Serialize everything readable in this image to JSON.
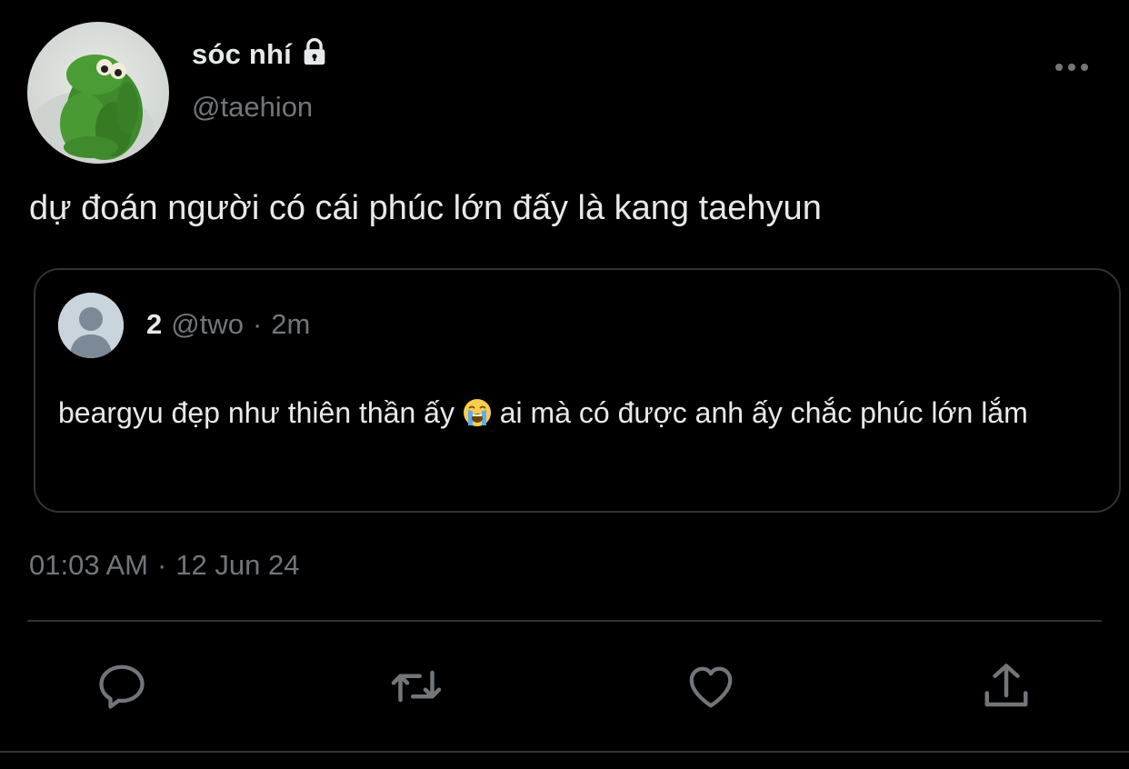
{
  "author": {
    "display_name": "sóc nhí",
    "handle": "@taehion",
    "protected": true,
    "avatar_icon": "kermit-frog-avatar"
  },
  "tweet": {
    "text": "dự đoán người có cái phúc lớn đấy là kang taehyun",
    "time": "01:03 AM",
    "separator": "·",
    "date": "12 Jun 24"
  },
  "quoted": {
    "name": "2",
    "handle": "@two",
    "separator": "·",
    "age": "2m",
    "text_before_emoji": "beargyu đẹp như thiên thần ấy ",
    "emoji": "loudly-crying-face-emoji",
    "text_after_emoji": " ai mà có được anh ấy chắc phúc lớn lắm",
    "avatar_icon": "default-user-avatar"
  },
  "actions": [
    {
      "name": "reply",
      "icon": "reply-icon"
    },
    {
      "name": "retweet",
      "icon": "retweet-icon"
    },
    {
      "name": "like",
      "icon": "heart-icon"
    },
    {
      "name": "share",
      "icon": "share-icon"
    }
  ],
  "colors": {
    "background": "#000000",
    "text_primary": "#e7e9ea",
    "text_secondary": "#71767b",
    "border": "#2f3336",
    "icon": "#71767b"
  }
}
